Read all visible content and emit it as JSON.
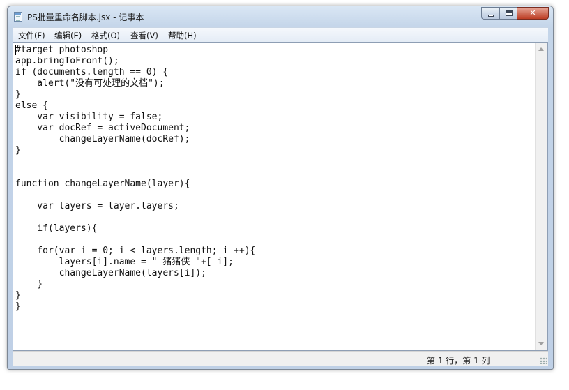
{
  "window": {
    "title": "PS批量重命名脚本.jsx - 记事本"
  },
  "menu": {
    "items": [
      {
        "label": "文件(F)"
      },
      {
        "label": "编辑(E)"
      },
      {
        "label": "格式(O)"
      },
      {
        "label": "查看(V)"
      },
      {
        "label": "帮助(H)"
      }
    ]
  },
  "editor": {
    "content": "#target photoshop\napp.bringToFront();\nif (documents.length == 0) {\n    alert(\"没有可处理的文档\");\n}\nelse {\n    var visibility = false;\n    var docRef = activeDocument;\n        changeLayerName(docRef);\n}\n\n\nfunction changeLayerName(layer){\n\n    var layers = layer.layers;\n\n    if(layers){\n\n    for(var i = 0; i < layers.length; i ++){\n        layers[i].name = \" 猪猪侠 \"+[ i];\n        changeLayerName(layers[i]);\n    }\n}\n}"
  },
  "status": {
    "position": "第 1 行，第 1 列"
  },
  "icons": {
    "app": "notepad-icon",
    "minimize": "minimize-icon",
    "maximize": "maximize-icon",
    "close": "close-icon",
    "scroll_up": "scroll-up-arrow-icon",
    "scroll_down": "scroll-down-arrow-icon"
  }
}
